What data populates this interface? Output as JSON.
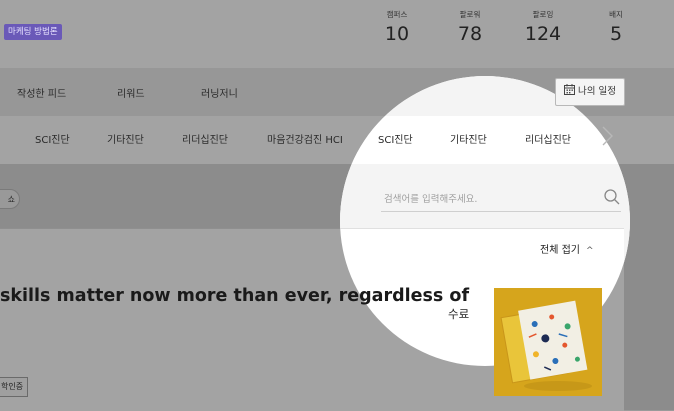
{
  "profile": {
    "badge": "마케팅 방법론"
  },
  "stats": [
    {
      "label": "캠퍼스",
      "value": "10"
    },
    {
      "label": "팔로워",
      "value": "78"
    },
    {
      "label": "팔로잉",
      "value": "124"
    },
    {
      "label": "배지",
      "value": "5"
    }
  ],
  "nav": {
    "items": [
      "작성한 피드",
      "리워드",
      "러닝저니"
    ],
    "schedule_button": "나의 일정"
  },
  "diagnosis_tabs": [
    "SCI진단",
    "기타진단",
    "리더십진단",
    "마음건강검진 HCI",
    "SCI진단",
    "기타진단",
    "리더십진단"
  ],
  "filter_pill": "쇼",
  "search": {
    "placeholder": "검색어를 입력해주세요."
  },
  "list": {
    "collapse_all": "전체 접기",
    "item": {
      "title": "skills matter now more than ever, regardless of",
      "status": "수료",
      "tag": "학인증"
    }
  },
  "colors": {
    "badge": "#6a59b8",
    "thumbnail_bg": "#d6a51c"
  }
}
